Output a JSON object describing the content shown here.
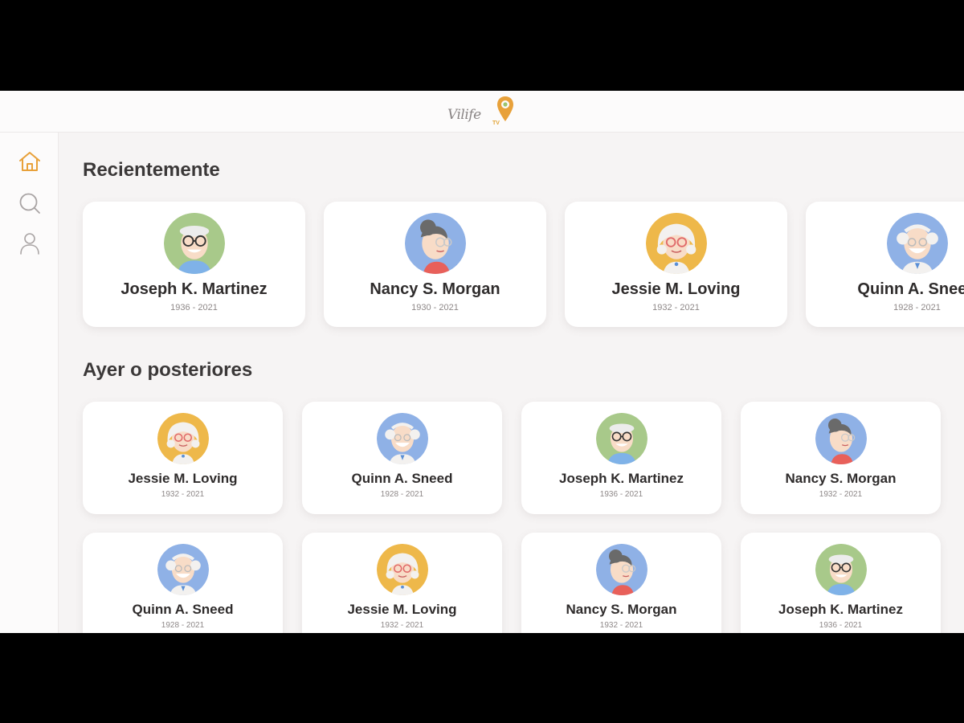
{
  "app": {
    "logo_text": "Vilife",
    "logo_sub": "TV",
    "accent": "#e8a13a"
  },
  "nav": [
    {
      "icon": "home-icon",
      "active": true
    },
    {
      "icon": "search-icon",
      "active": false
    },
    {
      "icon": "profile-icon",
      "active": false
    }
  ],
  "sections": {
    "recent": {
      "title": "Recientemente",
      "cards": [
        {
          "name": "Joseph K. Martinez",
          "years": "1936 - 2021",
          "avatar": "man-glasses-avatar",
          "bg": "#a8c98a"
        },
        {
          "name": "Nancy S. Morgan",
          "years": "1930 - 2021",
          "avatar": "woman-bun-avatar",
          "bg": "#8fb1e6"
        },
        {
          "name": "Jessie M. Loving",
          "years": "1932 - 2021",
          "avatar": "woman-white-hair-avatar",
          "bg": "#eeb84a"
        },
        {
          "name": "Quinn A. Sneed",
          "years": "1928 - 2021",
          "avatar": "bald-man-avatar",
          "bg": "#8fb1e6"
        }
      ]
    },
    "earlier": {
      "title": "Ayer o posteriores",
      "cards": [
        {
          "name": "Jessie M. Loving",
          "years": "1932 - 2021",
          "avatar": "woman-white-hair-avatar",
          "bg": "#eeb84a"
        },
        {
          "name": "Quinn A. Sneed",
          "years": "1928 - 2021",
          "avatar": "bald-man-avatar",
          "bg": "#8fb1e6"
        },
        {
          "name": "Joseph K. Martinez",
          "years": "1936 - 2021",
          "avatar": "man-glasses-avatar",
          "bg": "#a8c98a"
        },
        {
          "name": "Nancy S. Morgan",
          "years": "1932 - 2021",
          "avatar": "woman-bun-avatar",
          "bg": "#8fb1e6"
        },
        {
          "name": "Quinn A. Sneed",
          "years": "1928 - 2021",
          "avatar": "bald-man-avatar",
          "bg": "#8fb1e6"
        },
        {
          "name": "Jessie M. Loving",
          "years": "1932 - 2021",
          "avatar": "woman-white-hair-avatar",
          "bg": "#eeb84a"
        },
        {
          "name": "Nancy S. Morgan",
          "years": "1932 - 2021",
          "avatar": "woman-bun-avatar",
          "bg": "#8fb1e6"
        },
        {
          "name": "Joseph K. Martinez",
          "years": "1936 - 2021",
          "avatar": "man-glasses-avatar",
          "bg": "#a8c98a"
        }
      ]
    }
  }
}
